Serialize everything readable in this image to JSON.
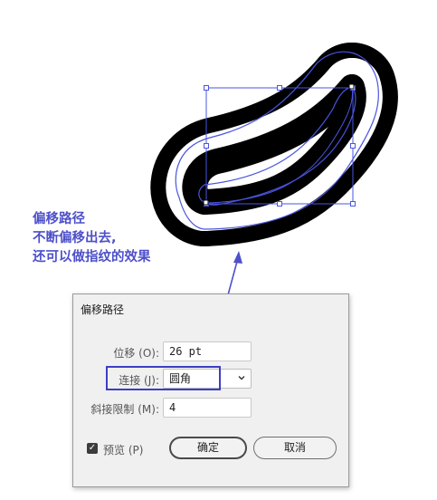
{
  "annotation": {
    "line1": "偏移路径",
    "line2": "不断偏移出去,",
    "line3": "还可以做指纹的效果"
  },
  "dialog": {
    "title": "偏移路径",
    "offset": {
      "label": "位移 (O):",
      "value": "26 pt"
    },
    "joins": {
      "label": "连接 (J):",
      "value": "圆角"
    },
    "miter_limit": {
      "label": "斜接限制 (M):",
      "value": "4"
    },
    "preview": {
      "label": "预览 (P)",
      "checked": true
    },
    "ok_label": "确定",
    "cancel_label": "取消"
  },
  "colors": {
    "annotation": "#4d50c9",
    "path_blue": "#4a55e0",
    "highlight": "#3b3fc4"
  },
  "icons": {
    "checkbox": "check-icon",
    "dropdown": "chevron-down-icon"
  }
}
